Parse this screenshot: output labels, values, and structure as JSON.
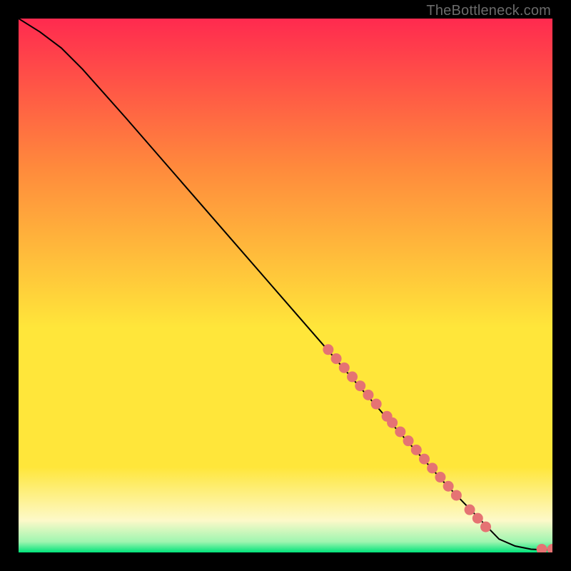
{
  "watermark": "TheBottleneck.com",
  "colors": {
    "black": "#000000",
    "curve": "#000000",
    "marker": "#e57373",
    "grad_top": "#ff2a4f",
    "grad_orange": "#ff8a3c",
    "grad_yellow": "#ffe63a",
    "grad_pale": "#fdf9c9",
    "grad_green": "#9ff5b0",
    "grad_green2": "#00e37a"
  },
  "chart_data": {
    "type": "line",
    "title": "",
    "xlabel": "",
    "ylabel": "",
    "xlim": [
      0,
      100
    ],
    "ylim": [
      0,
      100
    ],
    "curve": {
      "x": [
        0,
        4,
        8,
        12,
        20,
        30,
        40,
        50,
        60,
        70,
        80,
        90,
        93,
        96,
        98,
        100
      ],
      "y": [
        100,
        97.5,
        94.5,
        90.5,
        81.5,
        70,
        58.5,
        47,
        35.5,
        24,
        12.8,
        2.5,
        1.2,
        0.6,
        0.5,
        0.5
      ]
    },
    "markers": [
      {
        "x": 58,
        "y": 38
      },
      {
        "x": 59.5,
        "y": 36.3
      },
      {
        "x": 61,
        "y": 34.6
      },
      {
        "x": 62.5,
        "y": 32.9
      },
      {
        "x": 64,
        "y": 31.2
      },
      {
        "x": 65.5,
        "y": 29.5
      },
      {
        "x": 67,
        "y": 27.8
      },
      {
        "x": 69,
        "y": 25.5
      },
      {
        "x": 70,
        "y": 24.3
      },
      {
        "x": 71.5,
        "y": 22.6
      },
      {
        "x": 73,
        "y": 20.9
      },
      {
        "x": 74.5,
        "y": 19.2
      },
      {
        "x": 76,
        "y": 17.5
      },
      {
        "x": 77.5,
        "y": 15.8
      },
      {
        "x": 79,
        "y": 14.1
      },
      {
        "x": 80.5,
        "y": 12.4
      },
      {
        "x": 82,
        "y": 10.7
      },
      {
        "x": 84.5,
        "y": 8.0
      },
      {
        "x": 86,
        "y": 6.4
      },
      {
        "x": 87.5,
        "y": 4.8
      },
      {
        "x": 98,
        "y": 0.6
      },
      {
        "x": 100,
        "y": 0.6
      }
    ],
    "marker_radius_px": 7.5
  }
}
